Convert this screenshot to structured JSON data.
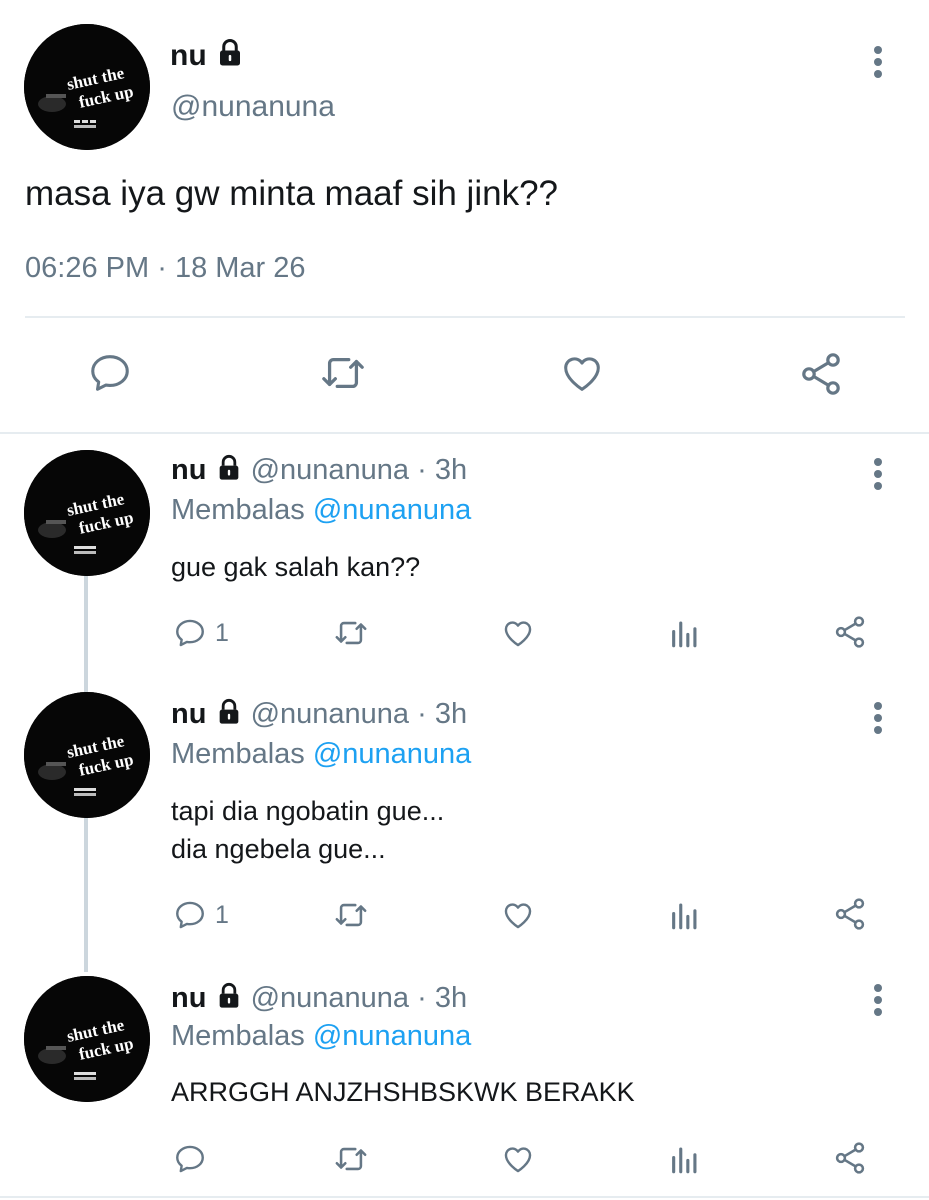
{
  "main_tweet": {
    "display_name": "nu",
    "handle": "@nunanuna",
    "avatar_text": [
      "shut the",
      "fuck up"
    ],
    "text": "masa iya gw minta maaf sih jink??",
    "time": "06:26 PM",
    "separator": "·",
    "date": "18 Mar 26",
    "actions": [
      "reply-icon",
      "retweet-icon",
      "like-icon",
      "share-icon"
    ]
  },
  "replies": [
    {
      "display_name": "nu",
      "handle": "@nunanuna",
      "dot": "·",
      "age": "3h",
      "replying_label": "Membalas",
      "replying_to": "@nunanuna",
      "lines": [
        "gue gak salah kan??"
      ],
      "reply_count": "1"
    },
    {
      "display_name": "nu",
      "handle": "@nunanuna",
      "dot": "·",
      "age": "3h",
      "replying_label": "Membalas",
      "replying_to": "@nunanuna",
      "lines": [
        "tapi dia ngobatin gue...",
        "dia ngebela gue..."
      ],
      "reply_count": "1"
    },
    {
      "display_name": "nu",
      "handle": "@nunanuna",
      "dot": "·",
      "age": "3h",
      "replying_label": "Membalas",
      "replying_to": "@nunanuna",
      "lines": [
        "ARRGGH ANJZHSHBSKWK BERAKK"
      ],
      "reply_count": ""
    }
  ],
  "colors": {
    "secondary_text": "#657786",
    "mention": "#1da1f2",
    "divider": "#e6ecf0",
    "thread_line": "#ccd6dd"
  }
}
